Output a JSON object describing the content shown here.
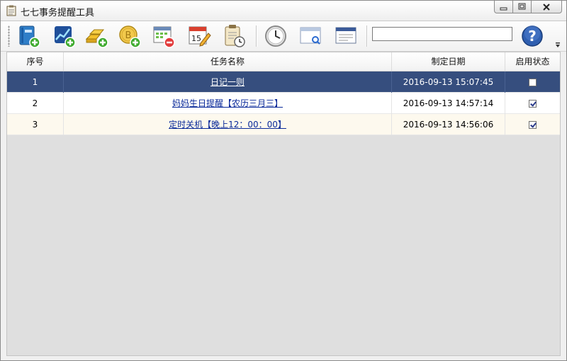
{
  "window": {
    "title": "七七事务提醒工具"
  },
  "toolbar": {
    "buttons": [
      {
        "icon": "new-diary-icon"
      },
      {
        "icon": "new-stock-icon"
      },
      {
        "icon": "new-gold-icon"
      },
      {
        "icon": "new-bitcoin-icon"
      },
      {
        "icon": "delete-calendar-icon"
      },
      {
        "icon": "calendar-edit-icon"
      },
      {
        "icon": "clipboard-clock-icon"
      },
      {
        "icon": "clock-icon"
      },
      {
        "icon": "window-search-icon"
      },
      {
        "icon": "window-settings-icon"
      },
      {
        "icon": "help-icon"
      }
    ],
    "search_value": ""
  },
  "table": {
    "columns": [
      "序号",
      "任务名称",
      "制定日期",
      "启用状态"
    ],
    "rows": [
      {
        "id": "1",
        "name": "日记一则",
        "date": "2016-09-13 15:07:45",
        "enabled": false,
        "selected": true
      },
      {
        "id": "2",
        "name": "妈妈生日提醒【农历三月三】",
        "date": "2016-09-13 14:57:14",
        "enabled": true,
        "selected": false
      },
      {
        "id": "3",
        "name": "定时关机【晚上12：00：00】",
        "date": "2016-09-13 14:56:06",
        "enabled": true,
        "selected": false
      }
    ]
  },
  "colors": {
    "selected_row": "#364e7e",
    "link": "#0a2a9a",
    "alt_row": "#fdf9ee"
  }
}
